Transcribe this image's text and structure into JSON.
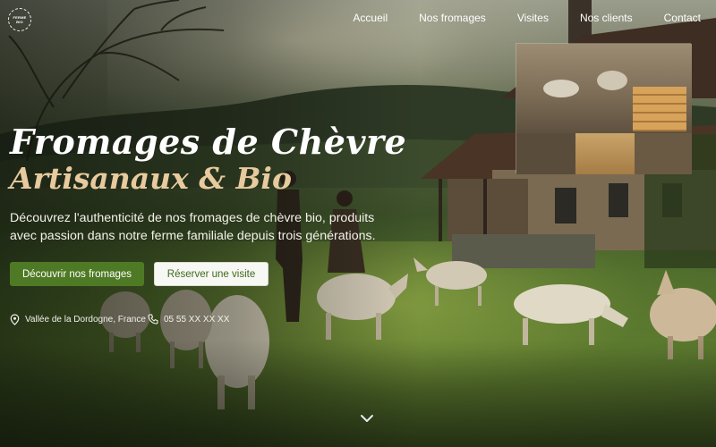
{
  "logo": {
    "line1": "FERME",
    "line2": "BIO"
  },
  "nav": {
    "items": [
      "Accueil",
      "Nos fromages",
      "Visites",
      "Nos clients",
      "Contact"
    ]
  },
  "hero": {
    "title": "Fromages de Chèvre",
    "subtitle": "Artisanaux & Bio",
    "description": "Découvrez l'authenticité de nos fromages de chèvre bio, produits avec passion dans notre ferme familiale depuis trois générations.",
    "primary_button": "Découvrir nos fromages",
    "secondary_button": "Réserver une visite",
    "location": "Vallée de la Dordogne, France",
    "phone": "05 55 XX XX XX"
  },
  "colors": {
    "accent_green": "#4f7a25",
    "subtitle_gold": "#e7ca9d",
    "text_white": "#ffffff"
  },
  "icons": [
    "location-pin-icon",
    "phone-icon",
    "chevron-down-icon"
  ]
}
